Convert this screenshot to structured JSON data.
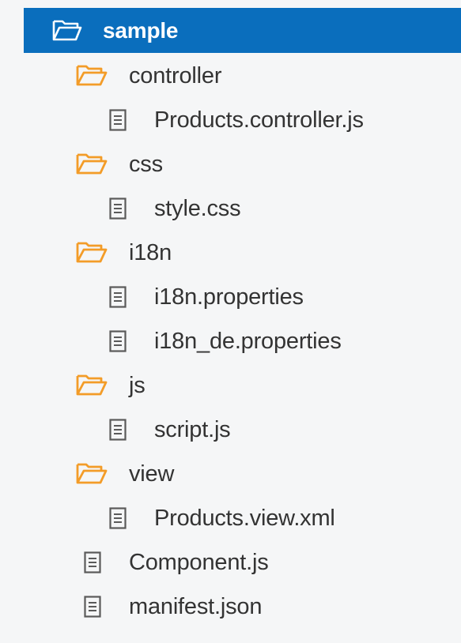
{
  "tree": {
    "items": [
      {
        "label": "sample",
        "type": "folder",
        "depth": 0,
        "selected": true,
        "icon": "folder-open-icon"
      },
      {
        "label": "controller",
        "type": "folder",
        "depth": 1,
        "icon": "folder-open-icon"
      },
      {
        "label": "Products.controller.js",
        "type": "file",
        "depth": 2,
        "icon": "file-icon"
      },
      {
        "label": "css",
        "type": "folder",
        "depth": 1,
        "icon": "folder-open-icon"
      },
      {
        "label": "style.css",
        "type": "file",
        "depth": 2,
        "icon": "file-icon"
      },
      {
        "label": "i18n",
        "type": "folder",
        "depth": 1,
        "icon": "folder-open-icon"
      },
      {
        "label": "i18n.properties",
        "type": "file",
        "depth": 2,
        "icon": "file-icon"
      },
      {
        "label": "i18n_de.properties",
        "type": "file",
        "depth": 2,
        "icon": "file-icon"
      },
      {
        "label": "js",
        "type": "folder",
        "depth": 1,
        "icon": "folder-open-icon"
      },
      {
        "label": "script.js",
        "type": "file",
        "depth": 2,
        "icon": "file-icon"
      },
      {
        "label": "view",
        "type": "folder",
        "depth": 1,
        "icon": "folder-open-icon"
      },
      {
        "label": "Products.view.xml",
        "type": "file",
        "depth": 2,
        "icon": "file-icon"
      },
      {
        "label": "Component.js",
        "type": "file",
        "depth": 1,
        "icon": "file-icon"
      },
      {
        "label": "manifest.json",
        "type": "file",
        "depth": 1,
        "icon": "file-icon"
      }
    ]
  },
  "colors": {
    "selection": "#0a6ebd",
    "folder": "#f39c28",
    "file_icon": "#5a5a5a",
    "text": "#333333",
    "background": "#f5f6f7"
  }
}
